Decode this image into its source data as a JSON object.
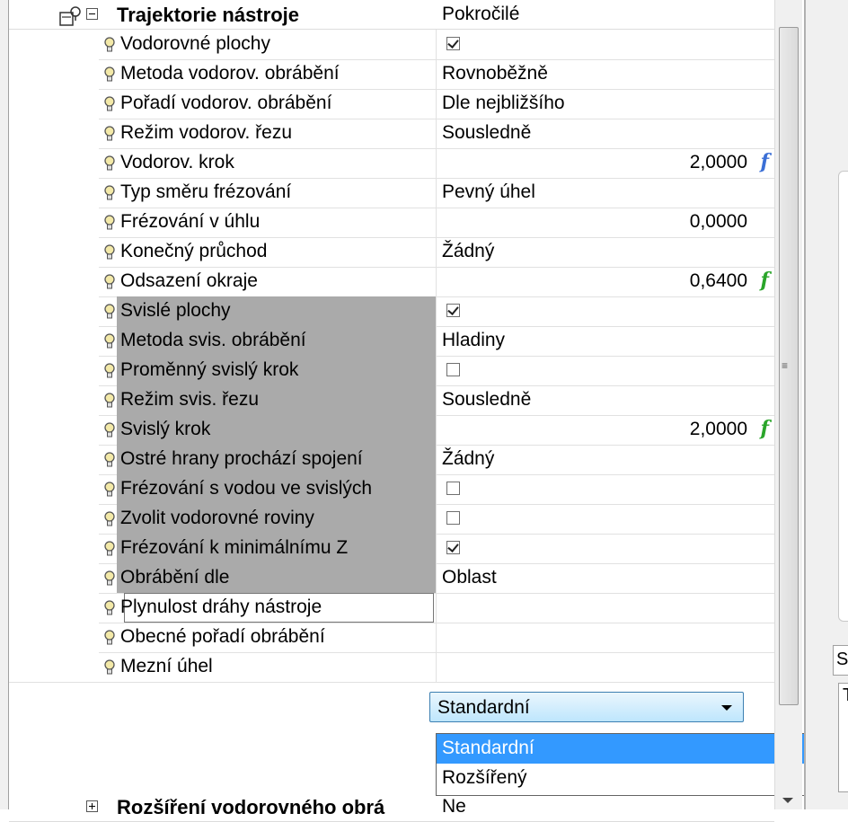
{
  "group": {
    "title": "Trajektorie nástroje",
    "value": "Pokročilé"
  },
  "rows": [
    {
      "name": "Vodorovné plochy",
      "kind": "check",
      "checked": true
    },
    {
      "name": "Metoda vodorov. obrábění",
      "value": "Rovnoběžně"
    },
    {
      "name": "Pořadí vodorov. obrábění",
      "value": "Dle nejbližšího"
    },
    {
      "name": "Režim vodorov. řezu",
      "value": "Sousledně"
    },
    {
      "name": "Vodorov. krok",
      "number": "2,0000",
      "fx": "f",
      "fx_color": "#3b6fd6"
    },
    {
      "name": "Typ směru frézování",
      "value": "Pevný úhel"
    },
    {
      "name": "Frézování v úhlu",
      "number": "0,0000"
    },
    {
      "name": "Konečný průchod",
      "value": "Žádný"
    },
    {
      "name": "Odsazení okraje",
      "number": "0,6400",
      "fx": "f",
      "fx_color": "#2aa52a"
    },
    {
      "name": "Svislé plochy",
      "kind": "check",
      "checked": true
    },
    {
      "name": "Metoda svis. obrábění",
      "value": "Hladiny"
    },
    {
      "name": "Proměnný svislý krok",
      "kind": "check",
      "checked": false
    },
    {
      "name": "Režim svis. řezu",
      "value": "Sousledně"
    },
    {
      "name": "Svislý krok",
      "number": "2,0000",
      "fx": "f",
      "fx_color": "#2aa52a"
    },
    {
      "name": "Ostré hrany prochází spojení",
      "value": "Žádný"
    },
    {
      "name": "Frézování s vodou ve svislých",
      "kind": "check",
      "checked": false
    },
    {
      "name": "Zvolit vodorovné roviny",
      "kind": "check",
      "checked": false
    },
    {
      "name": "Frézování k minimálnímu Z",
      "kind": "check",
      "checked": true
    },
    {
      "name": "Obrábění dle",
      "value": "Oblast"
    },
    {
      "name": "Plynulost dráhy nástroje",
      "kind": "combo",
      "value": "Standardní"
    },
    {
      "name": "Obecné pořadí obrábění",
      "value": ""
    },
    {
      "name": "Mezní úhel",
      "value": ""
    }
  ],
  "combo": {
    "selected": "Standardní"
  },
  "dropdown": {
    "options": [
      "Standardní",
      "Rozšířený"
    ]
  },
  "next_group": {
    "title": "Rozšíření vodorovného obrá",
    "value": "Ne"
  },
  "right_pane": {
    "tab_label": "Sle",
    "list_label": "T"
  }
}
